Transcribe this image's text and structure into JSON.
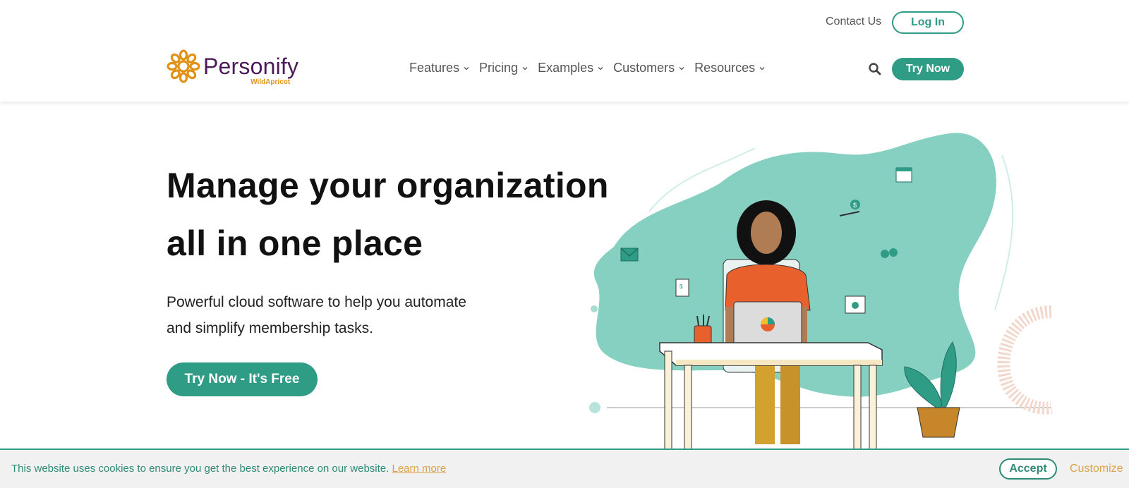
{
  "header": {
    "contact_label": "Contact Us",
    "login_label": "Log In",
    "logo": {
      "name": "Personify",
      "sub": "WildApricot"
    },
    "nav": [
      {
        "label": "Features"
      },
      {
        "label": "Pricing"
      },
      {
        "label": "Examples"
      },
      {
        "label": "Customers"
      },
      {
        "label": "Resources"
      }
    ],
    "search_icon": "search-icon",
    "try_now_label": "Try Now"
  },
  "hero": {
    "title_line1": "Manage your organization",
    "title_line2": "all in one place",
    "subtitle_line1": "Powerful cloud software to help you automate",
    "subtitle_line2": "and simplify membership tasks.",
    "cta_label": "Try Now - It's Free"
  },
  "cookie": {
    "text": "This website uses cookies to ensure you get the best experience on our website.",
    "learn_more": "Learn more",
    "accept_label": "Accept",
    "customize_label": "Customize"
  },
  "colors": {
    "brand_green": "#2f9c85",
    "logo_purple": "#4b1b57",
    "logo_orange": "#e39218",
    "cookie_gold": "#d9a24a",
    "blob_teal": "#86d0c2"
  }
}
